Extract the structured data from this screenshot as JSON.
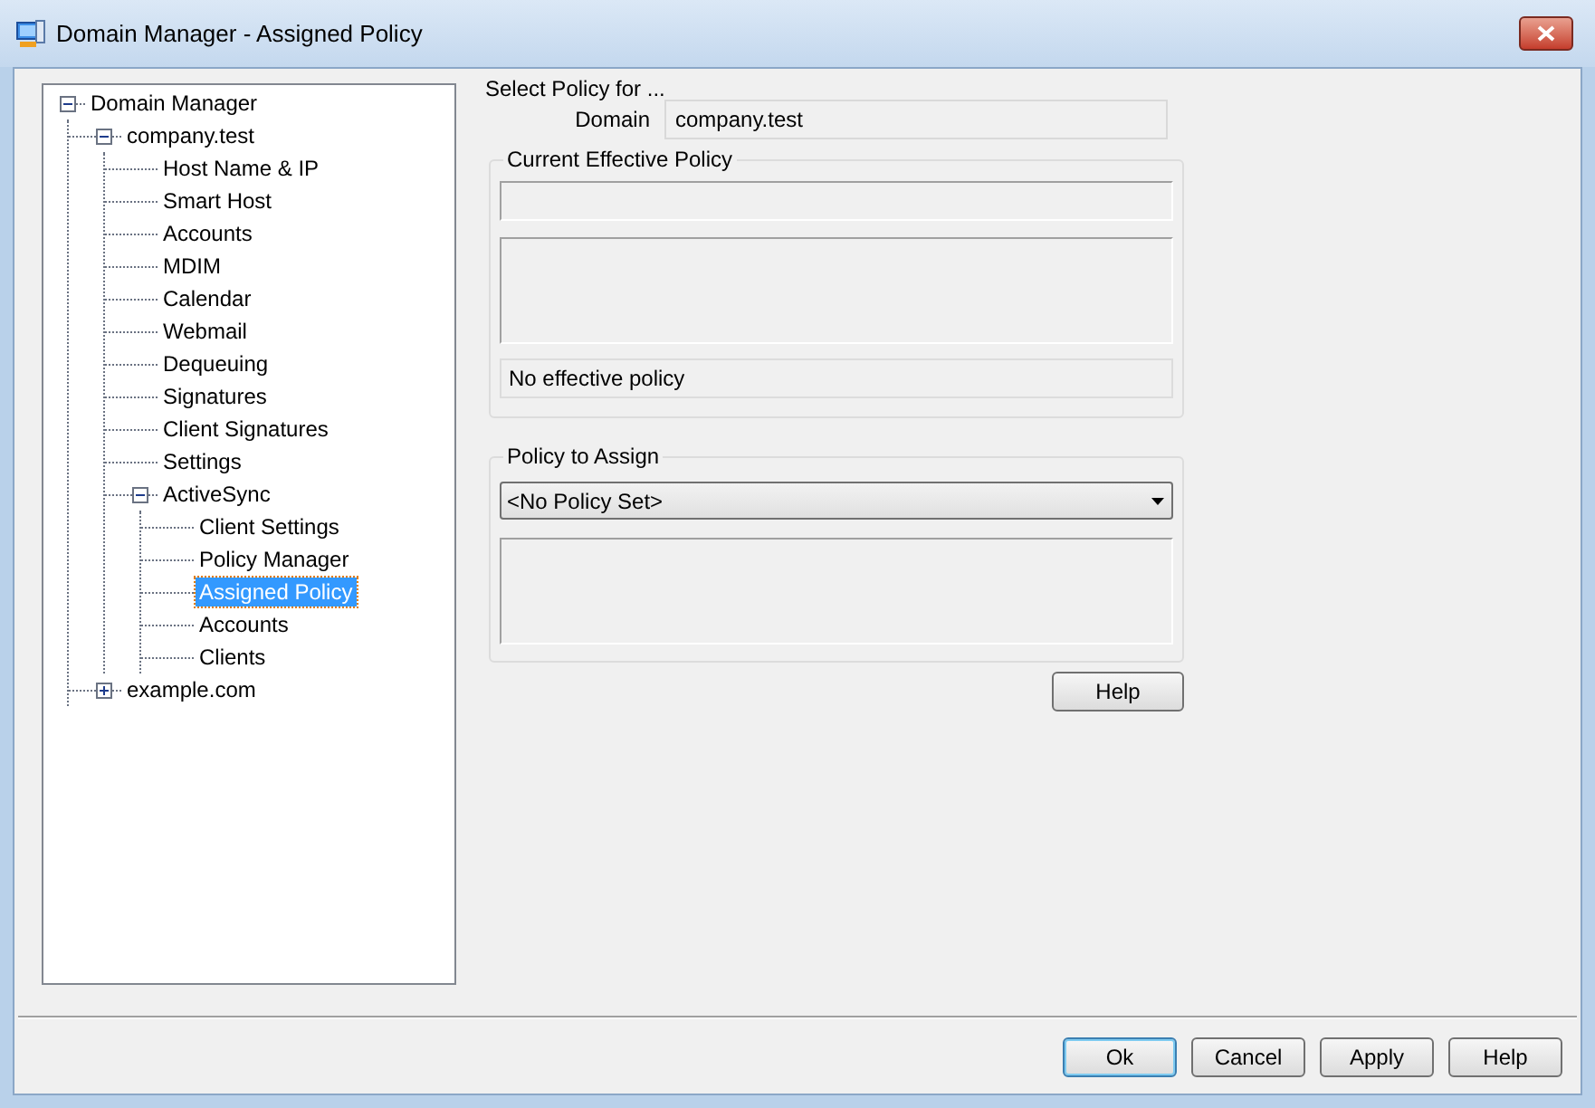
{
  "window": {
    "title": "Domain Manager - Assigned Policy"
  },
  "tree": [
    {
      "label": "Domain Manager",
      "selected": false,
      "expanded": true,
      "children": [
        {
          "label": "company.test",
          "selected": false,
          "expanded": true,
          "children": [
            {
              "label": "Host Name & IP",
              "selected": false
            },
            {
              "label": "Smart Host",
              "selected": false
            },
            {
              "label": "Accounts",
              "selected": false
            },
            {
              "label": "MDIM",
              "selected": false
            },
            {
              "label": "Calendar",
              "selected": false
            },
            {
              "label": "Webmail",
              "selected": false
            },
            {
              "label": "Dequeuing",
              "selected": false
            },
            {
              "label": "Signatures",
              "selected": false
            },
            {
              "label": "Client Signatures",
              "selected": false
            },
            {
              "label": "Settings",
              "selected": false
            },
            {
              "label": "ActiveSync",
              "selected": false,
              "expanded": true,
              "children": [
                {
                  "label": "Client Settings",
                  "selected": false
                },
                {
                  "label": "Policy Manager",
                  "selected": false
                },
                {
                  "label": "Assigned Policy",
                  "selected": true
                },
                {
                  "label": "Accounts",
                  "selected": false
                },
                {
                  "label": "Clients",
                  "selected": false
                }
              ]
            }
          ]
        },
        {
          "label": "example.com",
          "selected": false,
          "expanded": false
        }
      ]
    }
  ],
  "panel": {
    "heading": "Select Policy for ...",
    "domain_label": "Domain",
    "domain_value": "company.test",
    "current_group": {
      "title": "Current Effective Policy",
      "status": "No effective policy"
    },
    "assign_group": {
      "title": "Policy to Assign",
      "selected_policy": "<No Policy Set>"
    },
    "help_button": "Help"
  },
  "buttons": [
    {
      "label": "Ok",
      "default": true
    },
    {
      "label": "Cancel",
      "default": false
    },
    {
      "label": "Apply",
      "default": false
    },
    {
      "label": "Help",
      "default": false
    }
  ]
}
